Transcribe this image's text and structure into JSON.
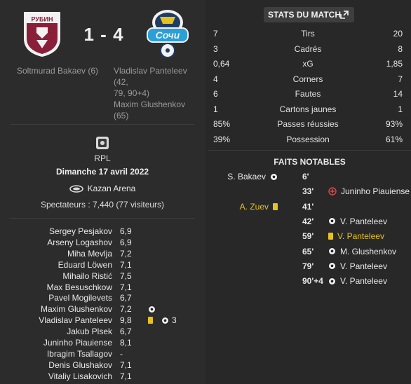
{
  "match": {
    "home_score": "1",
    "away_score": "4",
    "separator": "-",
    "home_crest": "Рубин Казань crest",
    "home_crest_text": "РУБИН",
    "away_crest": "Сочи crest",
    "away_crest_text": "Сочи",
    "home_scorers": "Soltmurad Bakaev (6)",
    "away_scorers_line1": "Vladislav Panteleev (42,",
    "away_scorers_line2": "79, 90+4)",
    "away_scorers_line3": "Maxim Glushenkov",
    "away_scorers_line4": "(65)"
  },
  "info": {
    "competition_icon": "rpl-logo-icon",
    "competition": "RPL",
    "date": "Dimanche 17 avril 2022",
    "stadium_icon": "stadium-icon",
    "stadium": "Kazan Arena",
    "spectators": "Spectateurs : 7,440 (77 visiteurs)"
  },
  "players": [
    {
      "name": "Sergey Pesjakov",
      "rating": "6,9"
    },
    {
      "name": "Arseny Logashov",
      "rating": "6,9"
    },
    {
      "name": "Miha Mevlja",
      "rating": "7,2"
    },
    {
      "name": "Eduard Löwen",
      "rating": "7,1"
    },
    {
      "name": "Mihailo Ristić",
      "rating": "7,5"
    },
    {
      "name": "Max Besuschkow",
      "rating": "7,1"
    },
    {
      "name": "Pavel Mogilevets",
      "rating": "6,7"
    },
    {
      "name": "Maxim Glushenkov",
      "rating": "7,2",
      "goals_icon": "ball-icon"
    },
    {
      "name": "Vladislav Panteleev",
      "rating": "9,8",
      "yellow": true,
      "goals_icon": "ball-icon",
      "goal_count": "3"
    },
    {
      "name": "Jakub Plsek",
      "rating": "6,7"
    },
    {
      "name": "Juninho Piauiense",
      "rating": "8,1"
    },
    {
      "name": "Ibragim Tsallagov",
      "rating": "-"
    },
    {
      "name": "Denis Glushakov",
      "rating": "7,1"
    },
    {
      "name": "Vitaliy Lisakovich",
      "rating": "7,1"
    }
  ],
  "stats": {
    "button_label": "STATS DU MATCH",
    "button_icon": "expand-icon",
    "rows": [
      {
        "label": "Tirs",
        "home": "7",
        "away": "20"
      },
      {
        "label": "Cadrés",
        "home": "3",
        "away": "8"
      },
      {
        "label": "xG",
        "home": "0,64",
        "away": "1,85"
      },
      {
        "label": "Corners",
        "home": "4",
        "away": "7"
      },
      {
        "label": "Fautes",
        "home": "6",
        "away": "14"
      },
      {
        "label": "Cartons jaunes",
        "home": "1",
        "away": "1"
      },
      {
        "label": "Passes réussies",
        "home": "85%",
        "away": "93%"
      },
      {
        "label": "Possession",
        "home": "39%",
        "away": "61%"
      }
    ]
  },
  "events": {
    "title": "FAITS NOTABLES",
    "rows": [
      {
        "minute": "6'",
        "side": "home",
        "player": "S. Bakaev",
        "icon": "ball-icon"
      },
      {
        "minute": "33'",
        "side": "away",
        "player": "Juninho Piauiense",
        "icon": "injury-icon"
      },
      {
        "minute": "41'",
        "side": "home",
        "player": "A. Zuev",
        "icon": "yellow-card-icon",
        "highlight": true
      },
      {
        "minute": "42'",
        "side": "away",
        "player": "V. Panteleev",
        "icon": "ball-icon"
      },
      {
        "minute": "59'",
        "side": "away",
        "player": "V. Panteleev",
        "icon": "yellow-card-icon",
        "highlight": true
      },
      {
        "minute": "65'",
        "side": "away",
        "player": "M. Glushenkov",
        "icon": "ball-icon"
      },
      {
        "minute": "79'",
        "side": "away",
        "player": "V. Panteleev",
        "icon": "ball-icon"
      },
      {
        "minute": "90'+4",
        "side": "away",
        "player": "V. Panteleev",
        "icon": "ball-icon"
      }
    ]
  },
  "colors": {
    "rubin_red": "#8a1f3a",
    "sochi_blue": "#2a9fd8",
    "yellow_card": "#e8c21c",
    "panel_bg": "#2c2c2c"
  }
}
